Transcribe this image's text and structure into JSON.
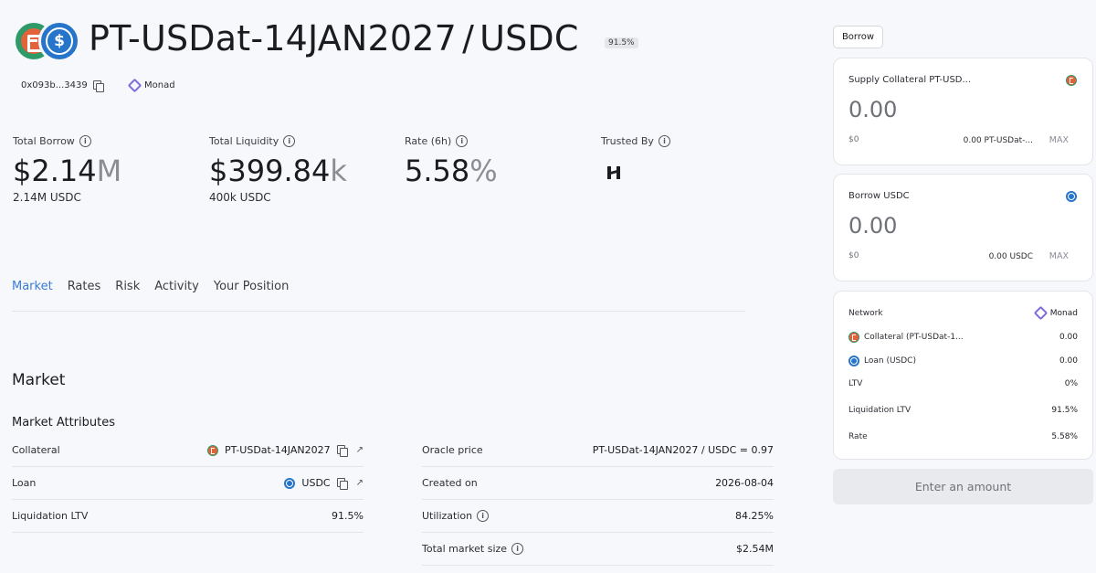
{
  "header": {
    "pair_base": "PT-USDat-14JAN2027",
    "pair_sep": "/",
    "pair_quote": "USDC",
    "ltv_chip": "91.5%",
    "address": "0x093b...3439",
    "network": "Monad"
  },
  "stats": {
    "total_borrow": {
      "label": "Total Borrow",
      "value": "$2.14",
      "unit": "M",
      "sub": "2.14M USDC"
    },
    "total_liquidity": {
      "label": "Total Liquidity",
      "value": "$399.84",
      "unit": "k",
      "sub": "400k USDC"
    },
    "rate": {
      "label": "Rate (6h)",
      "value": "5.58",
      "unit": "%"
    },
    "trusted_by": {
      "label": "Trusted By"
    }
  },
  "tabs": [
    {
      "label": "Market"
    },
    {
      "label": "Rates"
    },
    {
      "label": "Risk"
    },
    {
      "label": "Activity"
    },
    {
      "label": "Your Position"
    }
  ],
  "market": {
    "section_title": "Market",
    "attributes_title": "Market Attributes",
    "left_rows": [
      {
        "label": "Collateral",
        "value": "PT-USDat-14JAN2027"
      },
      {
        "label": "Loan",
        "value": "USDC"
      },
      {
        "label": "Liquidation LTV",
        "value": "91.5%"
      }
    ],
    "right_rows": [
      {
        "label": "Oracle price",
        "value": "PT-USDat-14JAN2027 / USDC = 0.97"
      },
      {
        "label": "Created on",
        "value": "2026-08-04"
      },
      {
        "label": "Utilization",
        "value": "84.25%"
      },
      {
        "label": "Total market size",
        "value": "$2.54M"
      }
    ]
  },
  "panel": {
    "tab_label": "Borrow",
    "supply": {
      "label": "Supply Collateral PT-USD...",
      "amount": "0.00",
      "usd": "$0",
      "balance": "0.00 PT-USDat-...",
      "max": "MAX"
    },
    "borrow": {
      "label": "Borrow USDC",
      "amount": "0.00",
      "usd": "$0",
      "balance": "0.00 USDC",
      "max": "MAX"
    },
    "summary": {
      "network_label": "Network",
      "network_value": "Monad",
      "collateral_label": "Collateral (PT-USDat-1...",
      "collateral_value": "0.00",
      "loan_label": "Loan (USDC)",
      "loan_value": "0.00",
      "ltv_label": "LTV",
      "ltv_value": "0%",
      "liq_label": "Liquidation LTV",
      "liq_value": "91.5%",
      "rate_label": "Rate",
      "rate_value": "5.58%"
    },
    "cta": "Enter an amount"
  },
  "colors": {
    "accent": "#3a7bd5",
    "usdc": "#2775ca",
    "pt": "#e2623a",
    "monad": "#7b6cd9"
  }
}
